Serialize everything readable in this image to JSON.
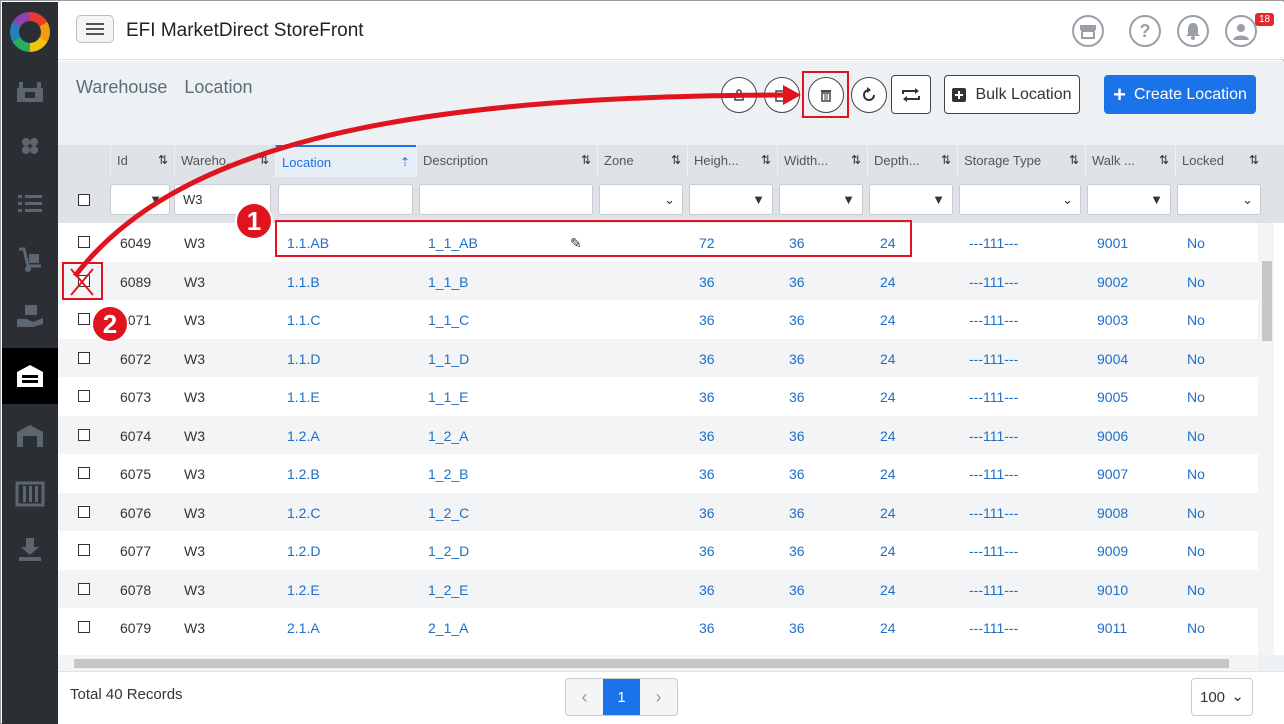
{
  "header": {
    "title": "EFI MarketDirect StoreFront",
    "notification_count": "18"
  },
  "breadcrumb": [
    "Warehouse",
    "Location"
  ],
  "toolbar": {
    "bulk_label": "Bulk Location",
    "create_label": "Create Location"
  },
  "filters": {
    "warehouse_value": "W3"
  },
  "columns": [
    "Id",
    "Wareho...",
    "Location",
    "Description",
    "Zone",
    "Heigh...",
    "Width...",
    "Depth...",
    "Storage Type",
    "Walk ...",
    "Locked"
  ],
  "rows": [
    {
      "id": "6049",
      "warehouse": "W3",
      "location": "1.1.AB",
      "description": "1_1_AB",
      "zone": "",
      "height": "72",
      "width": "36",
      "depth": "24",
      "storage": "---111---",
      "walk": "9001",
      "locked": "No"
    },
    {
      "id": "6089",
      "warehouse": "W3",
      "location": "1.1.B",
      "description": "1_1_B",
      "zone": "",
      "height": "36",
      "width": "36",
      "depth": "24",
      "storage": "---111---",
      "walk": "9002",
      "locked": "No"
    },
    {
      "id": "6071",
      "warehouse": "W3",
      "location": "1.1.C",
      "description": "1_1_C",
      "zone": "",
      "height": "36",
      "width": "36",
      "depth": "24",
      "storage": "---111---",
      "walk": "9003",
      "locked": "No"
    },
    {
      "id": "6072",
      "warehouse": "W3",
      "location": "1.1.D",
      "description": "1_1_D",
      "zone": "",
      "height": "36",
      "width": "36",
      "depth": "24",
      "storage": "---111---",
      "walk": "9004",
      "locked": "No"
    },
    {
      "id": "6073",
      "warehouse": "W3",
      "location": "1.1.E",
      "description": "1_1_E",
      "zone": "",
      "height": "36",
      "width": "36",
      "depth": "24",
      "storage": "---111---",
      "walk": "9005",
      "locked": "No"
    },
    {
      "id": "6074",
      "warehouse": "W3",
      "location": "1.2.A",
      "description": "1_2_A",
      "zone": "",
      "height": "36",
      "width": "36",
      "depth": "24",
      "storage": "---111---",
      "walk": "9006",
      "locked": "No"
    },
    {
      "id": "6075",
      "warehouse": "W3",
      "location": "1.2.B",
      "description": "1_2_B",
      "zone": "",
      "height": "36",
      "width": "36",
      "depth": "24",
      "storage": "---111---",
      "walk": "9007",
      "locked": "No"
    },
    {
      "id": "6076",
      "warehouse": "W3",
      "location": "1.2.C",
      "description": "1_2_C",
      "zone": "",
      "height": "36",
      "width": "36",
      "depth": "24",
      "storage": "---111---",
      "walk": "9008",
      "locked": "No"
    },
    {
      "id": "6077",
      "warehouse": "W3",
      "location": "1.2.D",
      "description": "1_2_D",
      "zone": "",
      "height": "36",
      "width": "36",
      "depth": "24",
      "storage": "---111---",
      "walk": "9009",
      "locked": "No"
    },
    {
      "id": "6078",
      "warehouse": "W3",
      "location": "1.2.E",
      "description": "1_2_E",
      "zone": "",
      "height": "36",
      "width": "36",
      "depth": "24",
      "storage": "---111---",
      "walk": "9010",
      "locked": "No"
    },
    {
      "id": "6079",
      "warehouse": "W3",
      "location": "2.1.A",
      "description": "2_1_A",
      "zone": "",
      "height": "36",
      "width": "36",
      "depth": "24",
      "storage": "---111---",
      "walk": "9011",
      "locked": "No"
    }
  ],
  "footer": {
    "total": "Total 40 Records",
    "current_page": "1",
    "page_size": "100"
  },
  "annotations": {
    "step1": "1",
    "step2": "2"
  },
  "colors": {
    "accent": "#1a73e8",
    "annotation": "#e0141e",
    "sidebar": "#2b2f33"
  }
}
